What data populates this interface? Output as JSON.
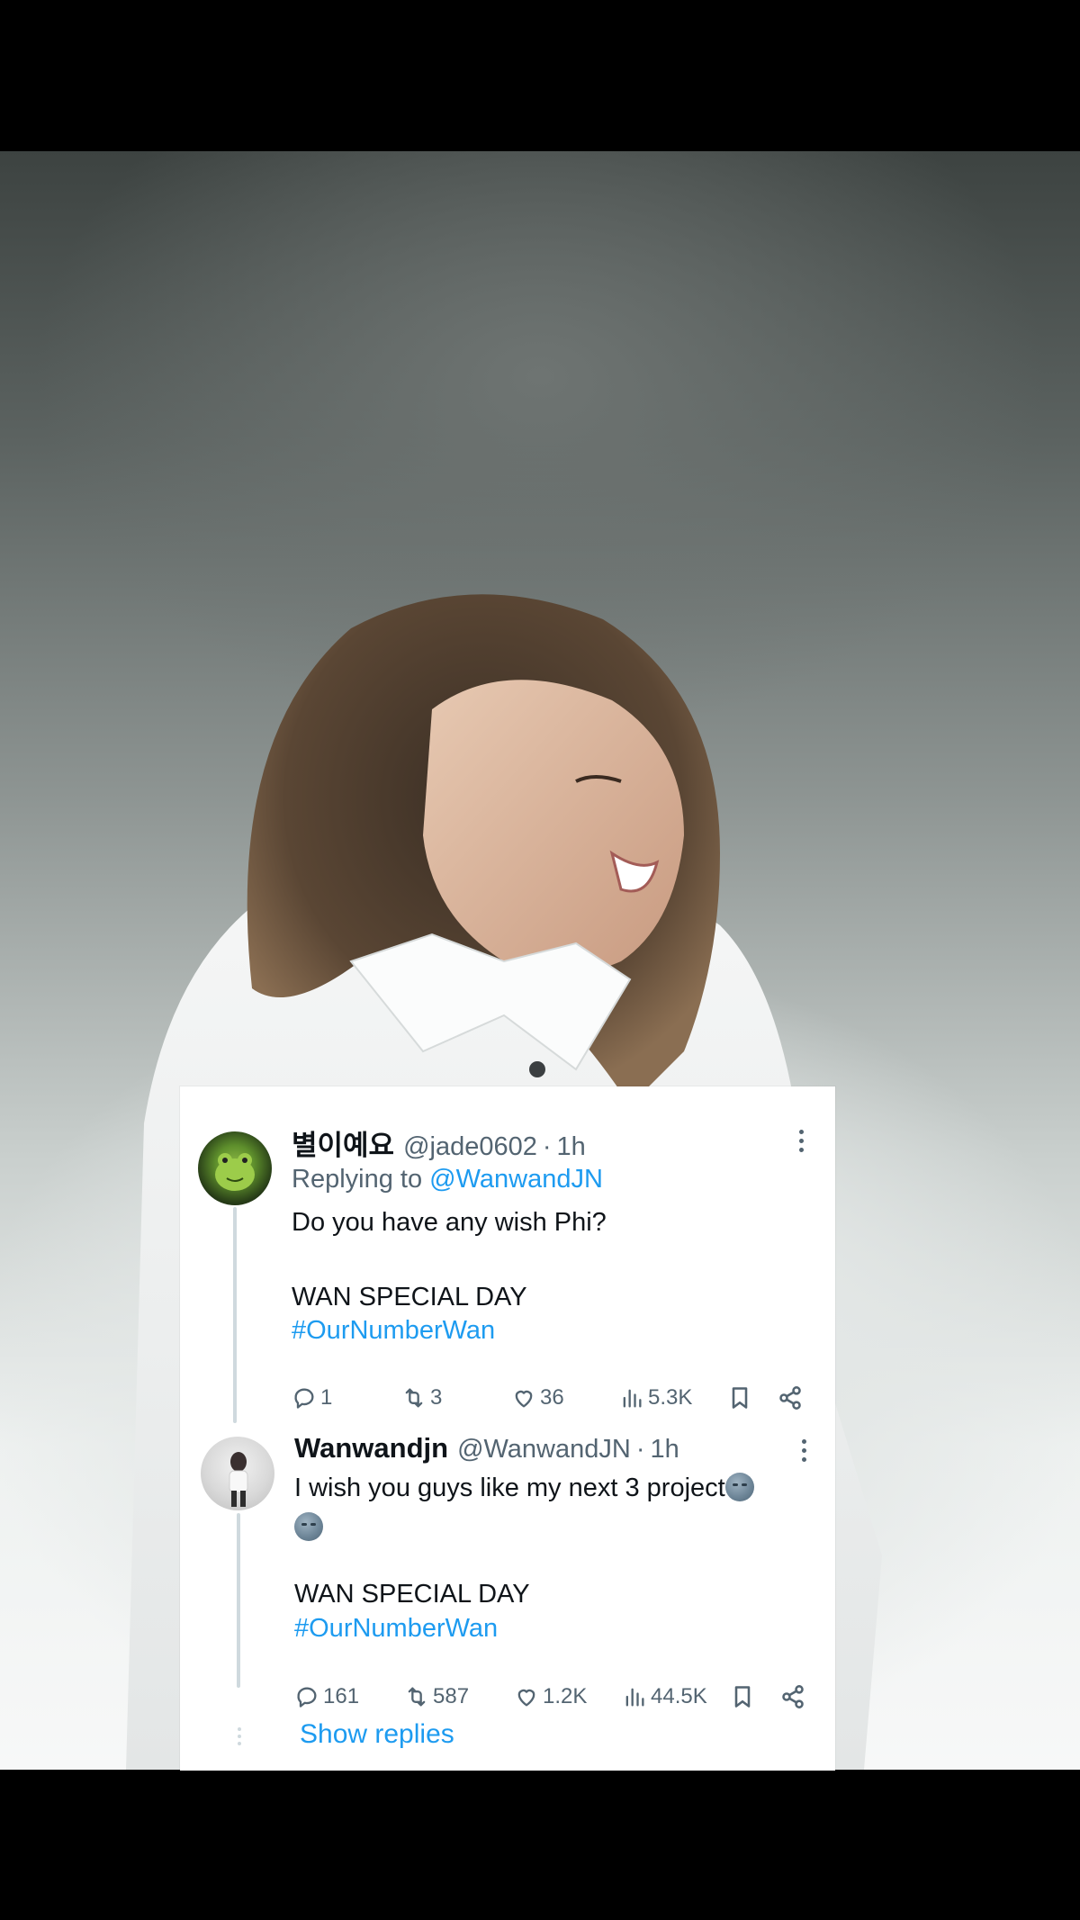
{
  "tweets": [
    {
      "name": "별이예요",
      "handle": "@jade0602",
      "dot": "·",
      "time": "1h",
      "replying_prefix": "Replying to",
      "replying_to": "@WanwandJN",
      "lines": [
        "Do you have any wish Phi?",
        "WAN SPECIAL DAY"
      ],
      "hashtag": "#OurNumberWan",
      "replies": "1",
      "retweets": "3",
      "likes": "36",
      "views": "5.3K"
    },
    {
      "name": "Wanwandjn",
      "handle": "@WanwandJN",
      "dot": "·",
      "time": "1h",
      "lines": [
        "I wish you guys like my next 3 project",
        "WAN SPECIAL DAY"
      ],
      "hashtag": "#OurNumberWan",
      "replies": "161",
      "retweets": "587",
      "likes": "1.2K",
      "views": "44.5K"
    }
  ],
  "show_replies": "Show replies",
  "colors": {
    "link": "#1d9bf0",
    "text": "#0f1419",
    "muted": "#536471"
  },
  "icons": [
    "reply-icon",
    "retweet-icon",
    "like-icon",
    "views-icon",
    "bookmark-icon",
    "share-icon",
    "more-icon",
    "moon-emoji-icon"
  ]
}
